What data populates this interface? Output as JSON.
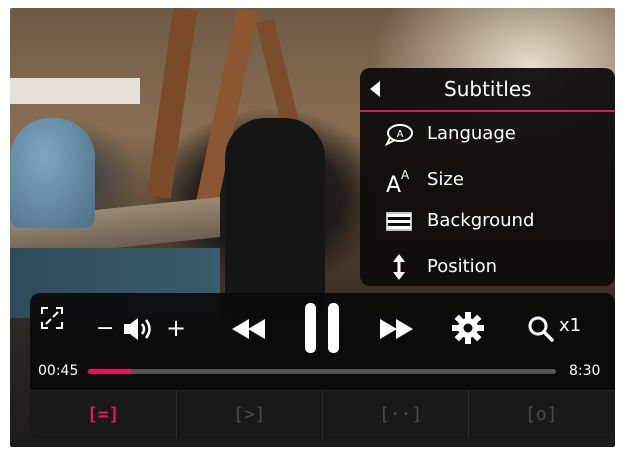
{
  "subtitles_menu": {
    "title": "Subtitles",
    "items": [
      {
        "label": "Language",
        "icon": "language-bubble-icon"
      },
      {
        "label": "Size",
        "icon": "text-size-icon"
      },
      {
        "label": "Background",
        "icon": "background-bars-icon"
      },
      {
        "label": "Position",
        "icon": "position-arrows-icon"
      }
    ]
  },
  "controls": {
    "volume_minus": "−",
    "volume_plus": "+",
    "zoom_level": "x1",
    "current_time": "00:45",
    "total_time": "8:30",
    "progress_fraction": 0.095
  },
  "bottom_tabs": [
    {
      "glyph": "[=]",
      "active": true
    },
    {
      "glyph": "[>]",
      "active": false
    },
    {
      "glyph": "[··]",
      "active": false
    },
    {
      "glyph": "[o]",
      "active": false
    }
  ],
  "colors": {
    "accent": "#e3165b",
    "inactive_glyph": "#4a4a4a"
  }
}
